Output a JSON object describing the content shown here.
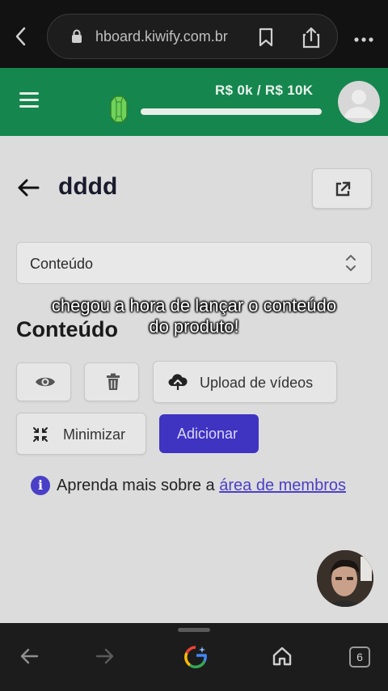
{
  "browser": {
    "url": "hboard.kiwify.com.br",
    "tab_count": "6"
  },
  "header": {
    "progress_label": "R$ 0k / R$ 10K",
    "progress_fraction": 0.0
  },
  "page": {
    "title": "dddd",
    "select_value": "Conteúdo",
    "section_title": "Conteúdo"
  },
  "buttons": {
    "upload_label": "Upload de vídeos",
    "minimize_label": "Minimizar",
    "add_label": "Adicionar"
  },
  "info": {
    "text": "Aprenda mais sobre a ",
    "link": "área de membros"
  },
  "overlay": {
    "caption_line1": "chegou a hora de lançar o conteúdo",
    "caption_line2": "do produto!"
  },
  "colors": {
    "header_green": "#14864e",
    "primary_purple": "#3f33c2"
  }
}
